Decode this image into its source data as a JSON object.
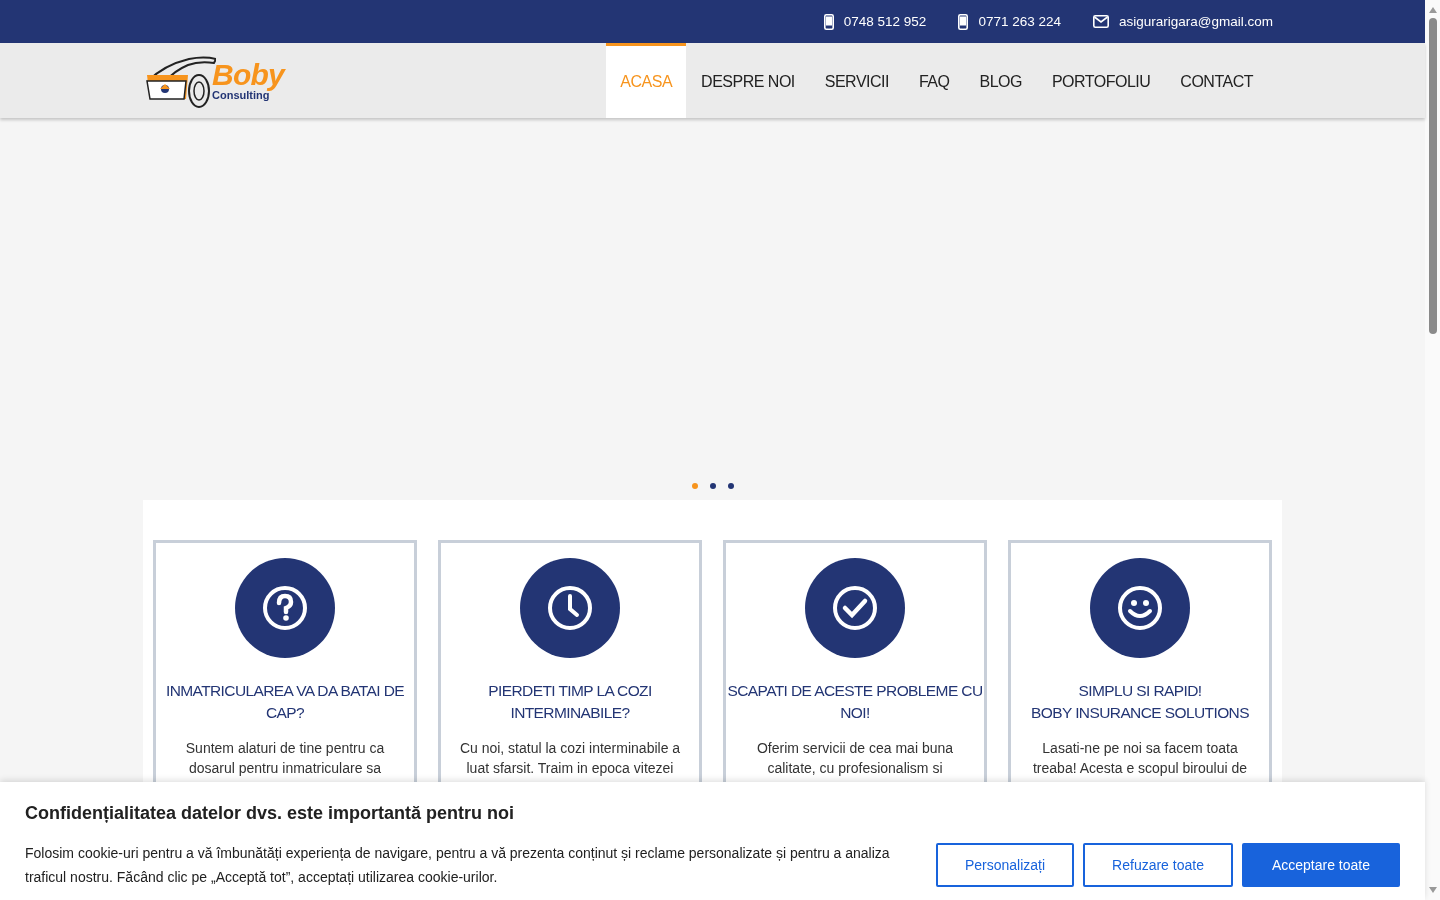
{
  "topbar": {
    "contacts": [
      {
        "kind": "phone",
        "text": "0748 512 952"
      },
      {
        "kind": "phone",
        "text": "0771 263 224"
      },
      {
        "kind": "email",
        "text": "asigurarigara@gmail.com"
      }
    ]
  },
  "logo": {
    "name": "Boby",
    "tagline": "Consulting"
  },
  "nav": [
    {
      "label": "ACASA",
      "selected": true
    },
    {
      "label": "DESPRE NOI",
      "selected": false
    },
    {
      "label": "SERVICII",
      "selected": false
    },
    {
      "label": "FAQ",
      "selected": false
    },
    {
      "label": "BLOG",
      "selected": false
    },
    {
      "label": "PORTOFOLIU",
      "selected": false
    },
    {
      "label": "CONTACT",
      "selected": false
    }
  ],
  "slider_dots": [
    {
      "selected": true
    },
    {
      "selected": false
    },
    {
      "selected": false
    }
  ],
  "features": [
    {
      "kind": "question",
      "title": [
        "INMATRICULAREA VA DA BATAI DE",
        "CAP?"
      ],
      "text": "Suntem alaturi de tine pentru ca dosarul pentru inmatriculare sa"
    },
    {
      "kind": "clock",
      "title": [
        "PIERDETI TIMP LA COZI",
        "INTERMINABILE?"
      ],
      "text": "Cu noi, statul la cozi interminabile a luat sfarsit. Traim in epoca vitezei"
    },
    {
      "kind": "check",
      "title": [
        "SCAPATI DE ACESTE PROBLEME CU",
        "NOI!"
      ],
      "text": "Oferim servicii de cea mai buna calitate, cu profesionalism si"
    },
    {
      "kind": "smile",
      "title": [
        "SIMPLU SI RAPID!",
        "BOBY INSURANCE SOLUTIONS"
      ],
      "text": "Lasati-ne pe noi sa facem toata treaba! Acesta e scopul biroului de"
    }
  ],
  "cookie_banner": {
    "title": "Confidențialitatea datelor dvs. este importantă pentru noi",
    "text": "Folosim cookie-uri pentru a vă îmbunătăți experiența de navigare, pentru a vă prezenta conținut și reclame personalizate și pentru a analiza traficul nostru. Făcând clic pe „Acceptă tot”, acceptați utilizarea cookie-urilor.",
    "buttons": [
      {
        "label": "Personalizați",
        "kind": "outline"
      },
      {
        "label": "Refuzare toate",
        "kind": "outline"
      },
      {
        "label": "Acceptare toate",
        "kind": "primary"
      }
    ]
  }
}
